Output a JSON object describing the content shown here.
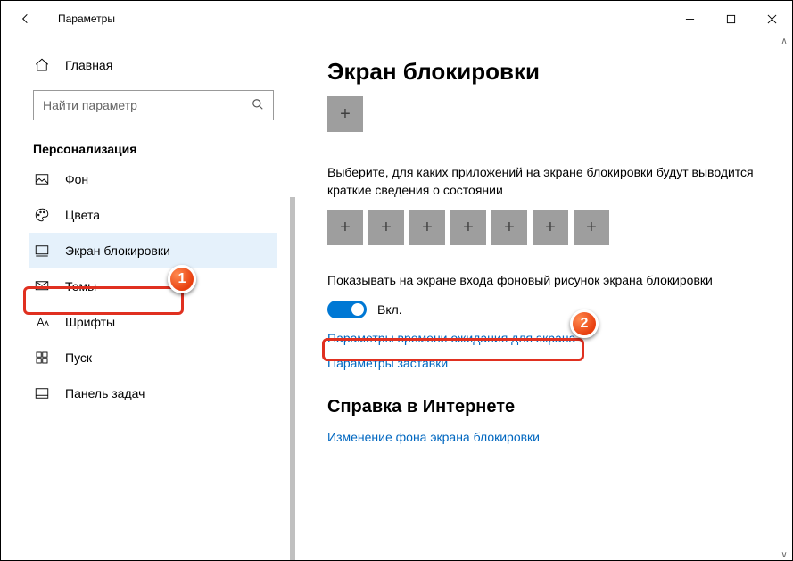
{
  "window": {
    "title": "Параметры"
  },
  "sidebar": {
    "home": "Главная",
    "search_placeholder": "Найти параметр",
    "section": "Персонализация",
    "items": [
      {
        "label": "Фон"
      },
      {
        "label": "Цвета"
      },
      {
        "label": "Экран блокировки"
      },
      {
        "label": "Темы"
      },
      {
        "label": "Шрифты"
      },
      {
        "label": "Пуск"
      },
      {
        "label": "Панель задач"
      }
    ]
  },
  "main": {
    "title": "Экран блокировки",
    "desc2": "Выберите, для каких приложений на экране блокировки будут выводится краткие сведения о состоянии",
    "desc3": "Показывать на экране входа фоновый рисунок экрана блокировки",
    "toggle_label": "Вкл.",
    "link_timeout": "Параметры времени ожидания для экрана",
    "link_saver": "Параметры заставки",
    "help_head": "Справка в Интернете",
    "link_help": "Изменение фона экрана блокировки"
  },
  "badges": {
    "one": "1",
    "two": "2"
  }
}
